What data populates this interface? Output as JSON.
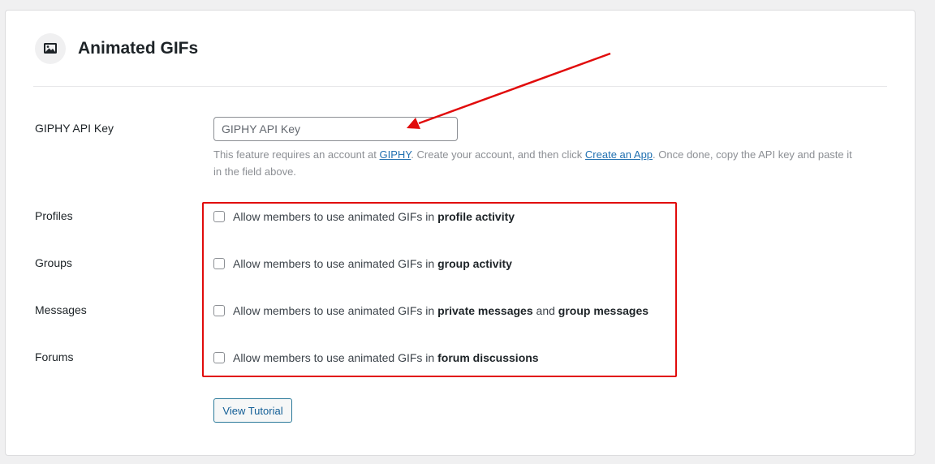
{
  "section": {
    "title": "Animated GIFs",
    "icon": "image-icon"
  },
  "api_key": {
    "label": "GIPHY API Key",
    "placeholder": "GIPHY API Key",
    "value": "",
    "help_prefix": "This feature requires an account at ",
    "help_link1": "GIPHY",
    "help_mid": ". Create your account, and then click ",
    "help_link2": "Create an App",
    "help_suffix": ". Once done, copy the API key and paste it in the field above."
  },
  "options": [
    {
      "label": "Profiles",
      "prefix": "Allow members to use animated GIFs in ",
      "bold1": "profile activity",
      "mid": "",
      "bold2": "",
      "checked": false
    },
    {
      "label": "Groups",
      "prefix": "Allow members to use animated GIFs in ",
      "bold1": "group activity",
      "mid": "",
      "bold2": "",
      "checked": false
    },
    {
      "label": "Messages",
      "prefix": "Allow members to use animated GIFs in ",
      "bold1": "private messages",
      "mid": " and ",
      "bold2": "group messages",
      "checked": false
    },
    {
      "label": "Forums",
      "prefix": "Allow members to use animated GIFs in ",
      "bold1": "forum discussions",
      "mid": "",
      "bold2": "",
      "checked": false
    }
  ],
  "tutorial_button": "View Tutorial",
  "colors": {
    "annotation_red": "#e10b0b",
    "link_blue": "#2271b1"
  }
}
